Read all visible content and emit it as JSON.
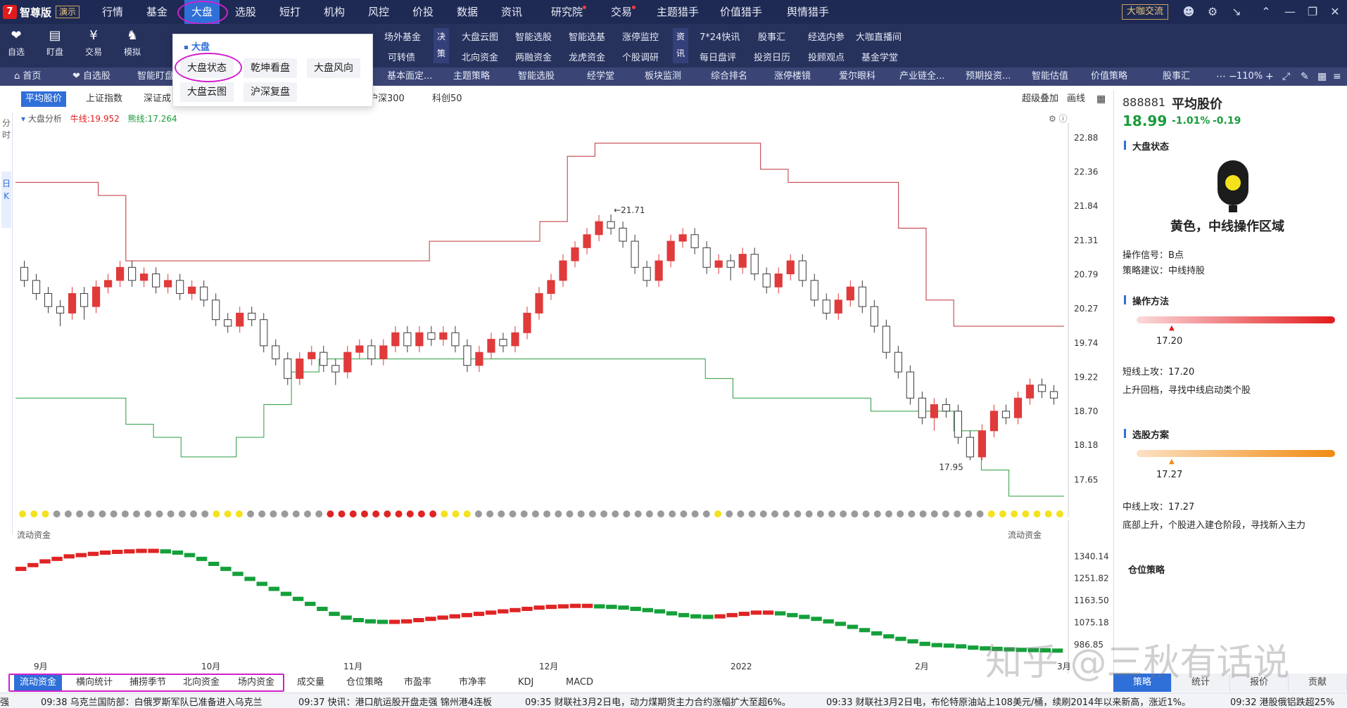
{
  "app": {
    "logo_mark": "7",
    "name": "智尊版",
    "demo_badge": "演示"
  },
  "menu": {
    "items": [
      "行情",
      "基金",
      "大盘",
      "选股",
      "短打",
      "机构",
      "风控",
      "价投",
      "数据",
      "资讯",
      "研究院",
      "交易",
      "主题猎手",
      "价值猎手",
      "舆情猎手"
    ],
    "active": "大盘",
    "exchange_button": "大咖交流"
  },
  "toolbar": {
    "tools": [
      {
        "label": "自选",
        "icon": "heart-icon"
      },
      {
        "label": "盯盘",
        "icon": "chart-icon"
      },
      {
        "label": "交易",
        "icon": "yen-icon"
      },
      {
        "label": "模拟",
        "icon": "gamepad-icon"
      }
    ],
    "col1": [
      "场外基金",
      "可转债"
    ],
    "group_jue": "决策",
    "col2": [
      "大盘云图",
      "北向资金"
    ],
    "col3": [
      "智能选股",
      "两融资金"
    ],
    "col4": [
      "智能选基",
      "龙虎资金"
    ],
    "col5": [
      "涨停监控",
      "个股调研"
    ],
    "group_xun": "资讯",
    "col6": [
      "7*24快讯",
      "每日盘评"
    ],
    "col7": [
      "股事汇",
      "投资日历"
    ],
    "col8": [
      "经选内参",
      "投顾观点"
    ],
    "col9": [
      "大咖直播间",
      "基金学堂"
    ]
  },
  "tabs": {
    "items": [
      "首页",
      "自选股",
      "智能盯盘",
      "基本面定...",
      "主题策略",
      "智能选股",
      "经学堂",
      "板块监测",
      "综合排名",
      "涨停楼镜",
      "爱尔眼科",
      "产业链全...",
      "预期投资...",
      "智能估值",
      "价值策略",
      "股事汇"
    ],
    "zoom": "110%"
  },
  "popover": {
    "title": "大盘",
    "items": [
      "大盘状态",
      "乾坤看盘",
      "大盘风向",
      "大盘云图",
      "沪深复盘"
    ]
  },
  "index_tabs": {
    "items": [
      "平均股价",
      "上证指数",
      "深证成",
      "沪深300",
      "科创50"
    ],
    "active": "平均股价",
    "right_items": [
      "超级叠加",
      "画线"
    ]
  },
  "left_strip": [
    "分时",
    "日K"
  ],
  "chart_legend": {
    "name": "大盘分析",
    "bull_label": "牛线:19.952",
    "bear_label": "熊线:17.264"
  },
  "chart_data": {
    "type": "candlestick",
    "ylim": [
      17.3,
      23.0
    ],
    "yticks": [
      22.88,
      22.36,
      21.84,
      21.31,
      20.79,
      20.27,
      19.74,
      19.22,
      18.7,
      18.18,
      17.65
    ],
    "annotations": [
      "21.71",
      "17.95"
    ],
    "x_tick_labels": [
      "9月",
      "10月",
      "11月",
      "12月",
      "2022",
      "2月",
      "3月"
    ],
    "candles": [
      [
        20.9,
        20.7,
        21.0,
        20.6
      ],
      [
        20.7,
        20.5,
        20.8,
        20.4
      ],
      [
        20.5,
        20.3,
        20.6,
        20.2
      ],
      [
        20.3,
        20.2,
        20.4,
        20.0
      ],
      [
        20.2,
        20.5,
        20.6,
        20.1
      ],
      [
        20.5,
        20.3,
        20.6,
        20.1
      ],
      [
        20.3,
        20.6,
        20.7,
        20.2
      ],
      [
        20.6,
        20.7,
        20.8,
        20.5
      ],
      [
        20.7,
        20.9,
        21.0,
        20.6
      ],
      [
        20.9,
        20.7,
        21.0,
        20.6
      ],
      [
        20.7,
        20.8,
        20.9,
        20.6
      ],
      [
        20.8,
        20.6,
        20.9,
        20.5
      ],
      [
        20.6,
        20.7,
        20.8,
        20.5
      ],
      [
        20.7,
        20.5,
        20.8,
        20.4
      ],
      [
        20.5,
        20.6,
        20.7,
        20.4
      ],
      [
        20.6,
        20.4,
        20.7,
        20.3
      ],
      [
        20.4,
        20.1,
        20.5,
        20.0
      ],
      [
        20.1,
        20.0,
        20.2,
        19.9
      ],
      [
        20.0,
        20.2,
        20.3,
        19.9
      ],
      [
        20.2,
        20.1,
        20.3,
        20.0
      ],
      [
        20.1,
        19.7,
        20.2,
        19.6
      ],
      [
        19.7,
        19.5,
        19.8,
        19.4
      ],
      [
        19.5,
        19.2,
        19.6,
        19.1
      ],
      [
        19.2,
        19.5,
        19.6,
        19.1
      ],
      [
        19.5,
        19.6,
        19.7,
        19.4
      ],
      [
        19.6,
        19.4,
        19.7,
        19.3
      ],
      [
        19.4,
        19.3,
        19.5,
        19.1
      ],
      [
        19.3,
        19.6,
        19.7,
        19.2
      ],
      [
        19.6,
        19.7,
        19.8,
        19.5
      ],
      [
        19.7,
        19.5,
        19.8,
        19.4
      ],
      [
        19.5,
        19.7,
        19.8,
        19.4
      ],
      [
        19.7,
        19.9,
        20.0,
        19.6
      ],
      [
        19.9,
        19.7,
        20.0,
        19.6
      ],
      [
        19.7,
        19.9,
        20.0,
        19.6
      ],
      [
        19.9,
        19.8,
        20.0,
        19.7
      ],
      [
        19.8,
        19.9,
        20.0,
        19.7
      ],
      [
        19.9,
        19.7,
        20.0,
        19.6
      ],
      [
        19.7,
        19.4,
        19.8,
        19.3
      ],
      [
        19.4,
        19.6,
        19.7,
        19.3
      ],
      [
        19.6,
        19.8,
        19.9,
        19.5
      ],
      [
        19.8,
        19.7,
        19.9,
        19.6
      ],
      [
        19.7,
        19.9,
        20.0,
        19.6
      ],
      [
        19.9,
        20.2,
        20.3,
        19.8
      ],
      [
        20.2,
        20.5,
        20.6,
        20.1
      ],
      [
        20.5,
        20.7,
        20.8,
        20.4
      ],
      [
        20.7,
        21.0,
        21.1,
        20.6
      ],
      [
        21.0,
        21.2,
        21.3,
        20.9
      ],
      [
        21.2,
        21.4,
        21.5,
        21.1
      ],
      [
        21.4,
        21.6,
        21.7,
        21.3
      ],
      [
        21.6,
        21.5,
        21.71,
        21.4
      ],
      [
        21.5,
        21.3,
        21.6,
        21.2
      ],
      [
        21.3,
        20.9,
        21.4,
        20.8
      ],
      [
        20.9,
        20.7,
        21.0,
        20.6
      ],
      [
        20.7,
        21.0,
        21.1,
        20.6
      ],
      [
        21.0,
        21.3,
        21.4,
        20.9
      ],
      [
        21.3,
        21.4,
        21.5,
        21.2
      ],
      [
        21.4,
        21.2,
        21.5,
        21.1
      ],
      [
        21.2,
        20.9,
        21.3,
        20.8
      ],
      [
        20.9,
        21.0,
        21.1,
        20.8
      ],
      [
        21.0,
        20.9,
        21.1,
        20.7
      ],
      [
        20.9,
        21.1,
        21.2,
        20.8
      ],
      [
        21.1,
        20.8,
        21.2,
        20.7
      ],
      [
        20.8,
        20.6,
        20.9,
        20.5
      ],
      [
        20.6,
        20.8,
        20.9,
        20.5
      ],
      [
        20.8,
        21.0,
        21.1,
        20.7
      ],
      [
        21.0,
        20.7,
        21.1,
        20.6
      ],
      [
        20.7,
        20.4,
        20.8,
        20.3
      ],
      [
        20.4,
        20.2,
        20.5,
        20.1
      ],
      [
        20.2,
        20.4,
        20.5,
        20.1
      ],
      [
        20.4,
        20.6,
        20.7,
        20.3
      ],
      [
        20.6,
        20.3,
        20.7,
        20.2
      ],
      [
        20.3,
        20.0,
        20.4,
        19.9
      ],
      [
        20.0,
        19.6,
        20.1,
        19.5
      ],
      [
        19.6,
        19.3,
        19.7,
        19.2
      ],
      [
        19.3,
        18.9,
        19.4,
        18.8
      ],
      [
        18.9,
        18.6,
        19.0,
        18.5
      ],
      [
        18.6,
        18.8,
        18.9,
        18.4
      ],
      [
        18.8,
        18.7,
        18.9,
        18.6
      ],
      [
        18.7,
        18.3,
        18.8,
        18.2
      ],
      [
        18.3,
        18.0,
        18.4,
        17.95
      ],
      [
        18.0,
        18.4,
        18.5,
        17.95
      ],
      [
        18.4,
        18.7,
        18.8,
        18.3
      ],
      [
        18.7,
        18.6,
        18.8,
        18.5
      ],
      [
        18.6,
        18.9,
        19.0,
        18.5
      ],
      [
        18.9,
        19.1,
        19.2,
        18.8
      ],
      [
        19.1,
        19.0,
        19.2,
        18.9
      ],
      [
        19.0,
        18.9,
        19.1,
        18.8
      ]
    ],
    "bull_line": [
      22.2,
      22.2,
      22.2,
      22.0,
      21.0,
      21.0,
      21.0,
      21.0,
      21.0,
      21.0,
      21.0,
      21.0,
      21.0,
      21.0,
      21.0,
      21.3,
      21.3,
      21.3,
      21.3,
      21.6,
      22.6,
      22.8,
      22.8,
      22.8,
      22.8,
      22.8,
      22.8,
      22.4,
      22.2,
      22.2,
      22.2,
      22.2,
      21.5,
      20.4,
      20.0,
      20.0,
      20.0,
      20.0
    ],
    "bear_line": [
      18.9,
      18.9,
      18.9,
      18.9,
      18.5,
      18.3,
      18.0,
      18.0,
      18.3,
      18.8,
      19.3,
      19.5,
      19.5,
      19.5,
      19.5,
      19.5,
      19.5,
      19.5,
      19.5,
      19.5,
      19.5,
      19.5,
      19.5,
      19.5,
      19.5,
      19.2,
      18.9,
      18.9,
      18.9,
      18.9,
      18.9,
      18.7,
      18.7,
      18.7,
      18.4,
      17.8,
      17.4,
      17.4
    ],
    "status_dots": [
      "yellow",
      "yellow",
      "yellow",
      "gray",
      "gray",
      "gray",
      "gray",
      "gray",
      "gray",
      "gray",
      "gray",
      "gray",
      "gray",
      "gray",
      "gray",
      "gray",
      "gray",
      "yellow",
      "yellow",
      "yellow",
      "gray",
      "gray",
      "gray",
      "gray",
      "gray",
      "gray",
      "gray",
      "red",
      "red",
      "red",
      "red",
      "red",
      "red",
      "red",
      "red",
      "red",
      "red",
      "yellow",
      "yellow",
      "yellow",
      "gray",
      "gray",
      "gray",
      "gray",
      "gray",
      "gray",
      "gray",
      "gray",
      "gray",
      "gray",
      "gray",
      "gray",
      "gray",
      "gray",
      "gray",
      "gray",
      "gray",
      "gray",
      "gray",
      "gray",
      "gray",
      "yellow",
      "gray",
      "gray",
      "gray",
      "gray",
      "gray",
      "gray",
      "gray",
      "gray",
      "gray",
      "gray",
      "gray",
      "gray",
      "gray",
      "gray",
      "gray",
      "gray",
      "gray",
      "gray",
      "gray",
      "gray",
      "gray",
      "gray",
      "gray",
      "yellow",
      "yellow",
      "yellow",
      "yellow",
      "yellow",
      "yellow",
      "yellow"
    ],
    "flow": {
      "name": "流动资金",
      "ylim": [
        950,
        1400
      ],
      "yticks": [
        1340.14,
        1251.82,
        1163.5,
        1075.18,
        986.85
      ],
      "values": [
        1290,
        1305,
        1320,
        1330,
        1340,
        1345,
        1350,
        1355,
        1358,
        1360,
        1362,
        1362,
        1360,
        1355,
        1345,
        1330,
        1310,
        1290,
        1270,
        1250,
        1230,
        1210,
        1190,
        1170,
        1150,
        1130,
        1110,
        1095,
        1085,
        1080,
        1078,
        1078,
        1080,
        1085,
        1090,
        1095,
        1100,
        1105,
        1110,
        1115,
        1120,
        1125,
        1130,
        1135,
        1138,
        1140,
        1142,
        1142,
        1140,
        1138,
        1135,
        1130,
        1125,
        1120,
        1112,
        1105,
        1100,
        1098,
        1100,
        1105,
        1110,
        1115,
        1115,
        1112,
        1105,
        1098,
        1090,
        1080,
        1070,
        1058,
        1045,
        1032,
        1020,
        1010,
        1000,
        990,
        985,
        983,
        980,
        975,
        972,
        970,
        968,
        966,
        965,
        964,
        963
      ]
    }
  },
  "chart_labels": {
    "flow_left": "流动资金",
    "flow_right": "流动资金"
  },
  "bottom_tabs": {
    "items": [
      "流动资金",
      "横向统计",
      "捕捞季节",
      "北向资金",
      "场内资金",
      "成交量",
      "仓位策略",
      "市盈率",
      "市净率",
      "KDJ",
      "MACD"
    ],
    "active": "流动资金"
  },
  "ticker": [
    "强",
    "09:38 乌克兰国防部：白俄罗斯军队已准备进入乌克兰",
    "09:37 快讯：港口航运股开盘走强 锦州港4连板",
    "09:35 财联社3月2日电，动力煤期货主力合约涨幅扩大至超6%。",
    "09:33 财联社3月2日电，布伦特原油站上108美元/桶，续刷2014年以来新高，涨近1%。",
    "09:32 港股俄铝跌超25%"
  ],
  "right_panel": {
    "code": "888881",
    "name": "平均股价",
    "price": "18.99",
    "change_pct": "-1.01%",
    "change": "-0.19",
    "section_state": "大盘状态",
    "state_text": "黄色，中线操作区域",
    "signal": "操作信号：B点",
    "advice": "策略建议：中线持股",
    "section_method": "操作方法",
    "method_value": "17.20",
    "short_up": "短线上攻：17.20",
    "short_desc": "上升回档，寻找中线启动类个股",
    "section_pick": "选股方案",
    "pick_value": "17.27",
    "mid_up": "中线上攻：17.27",
    "mid_desc": "底部上升，个股进入建仓阶段，寻找新入主力",
    "section_position": "仓位策略",
    "tabs": [
      "策略",
      "统计",
      "报价",
      "贡献"
    ],
    "active_tab": "策略",
    "colors": {
      "up": "#e21b1b",
      "down": "#1a9c3b",
      "accent": "#2f6fd8",
      "yellow": "#f4d21e"
    }
  },
  "watermark": "知乎 @三秋有话说"
}
